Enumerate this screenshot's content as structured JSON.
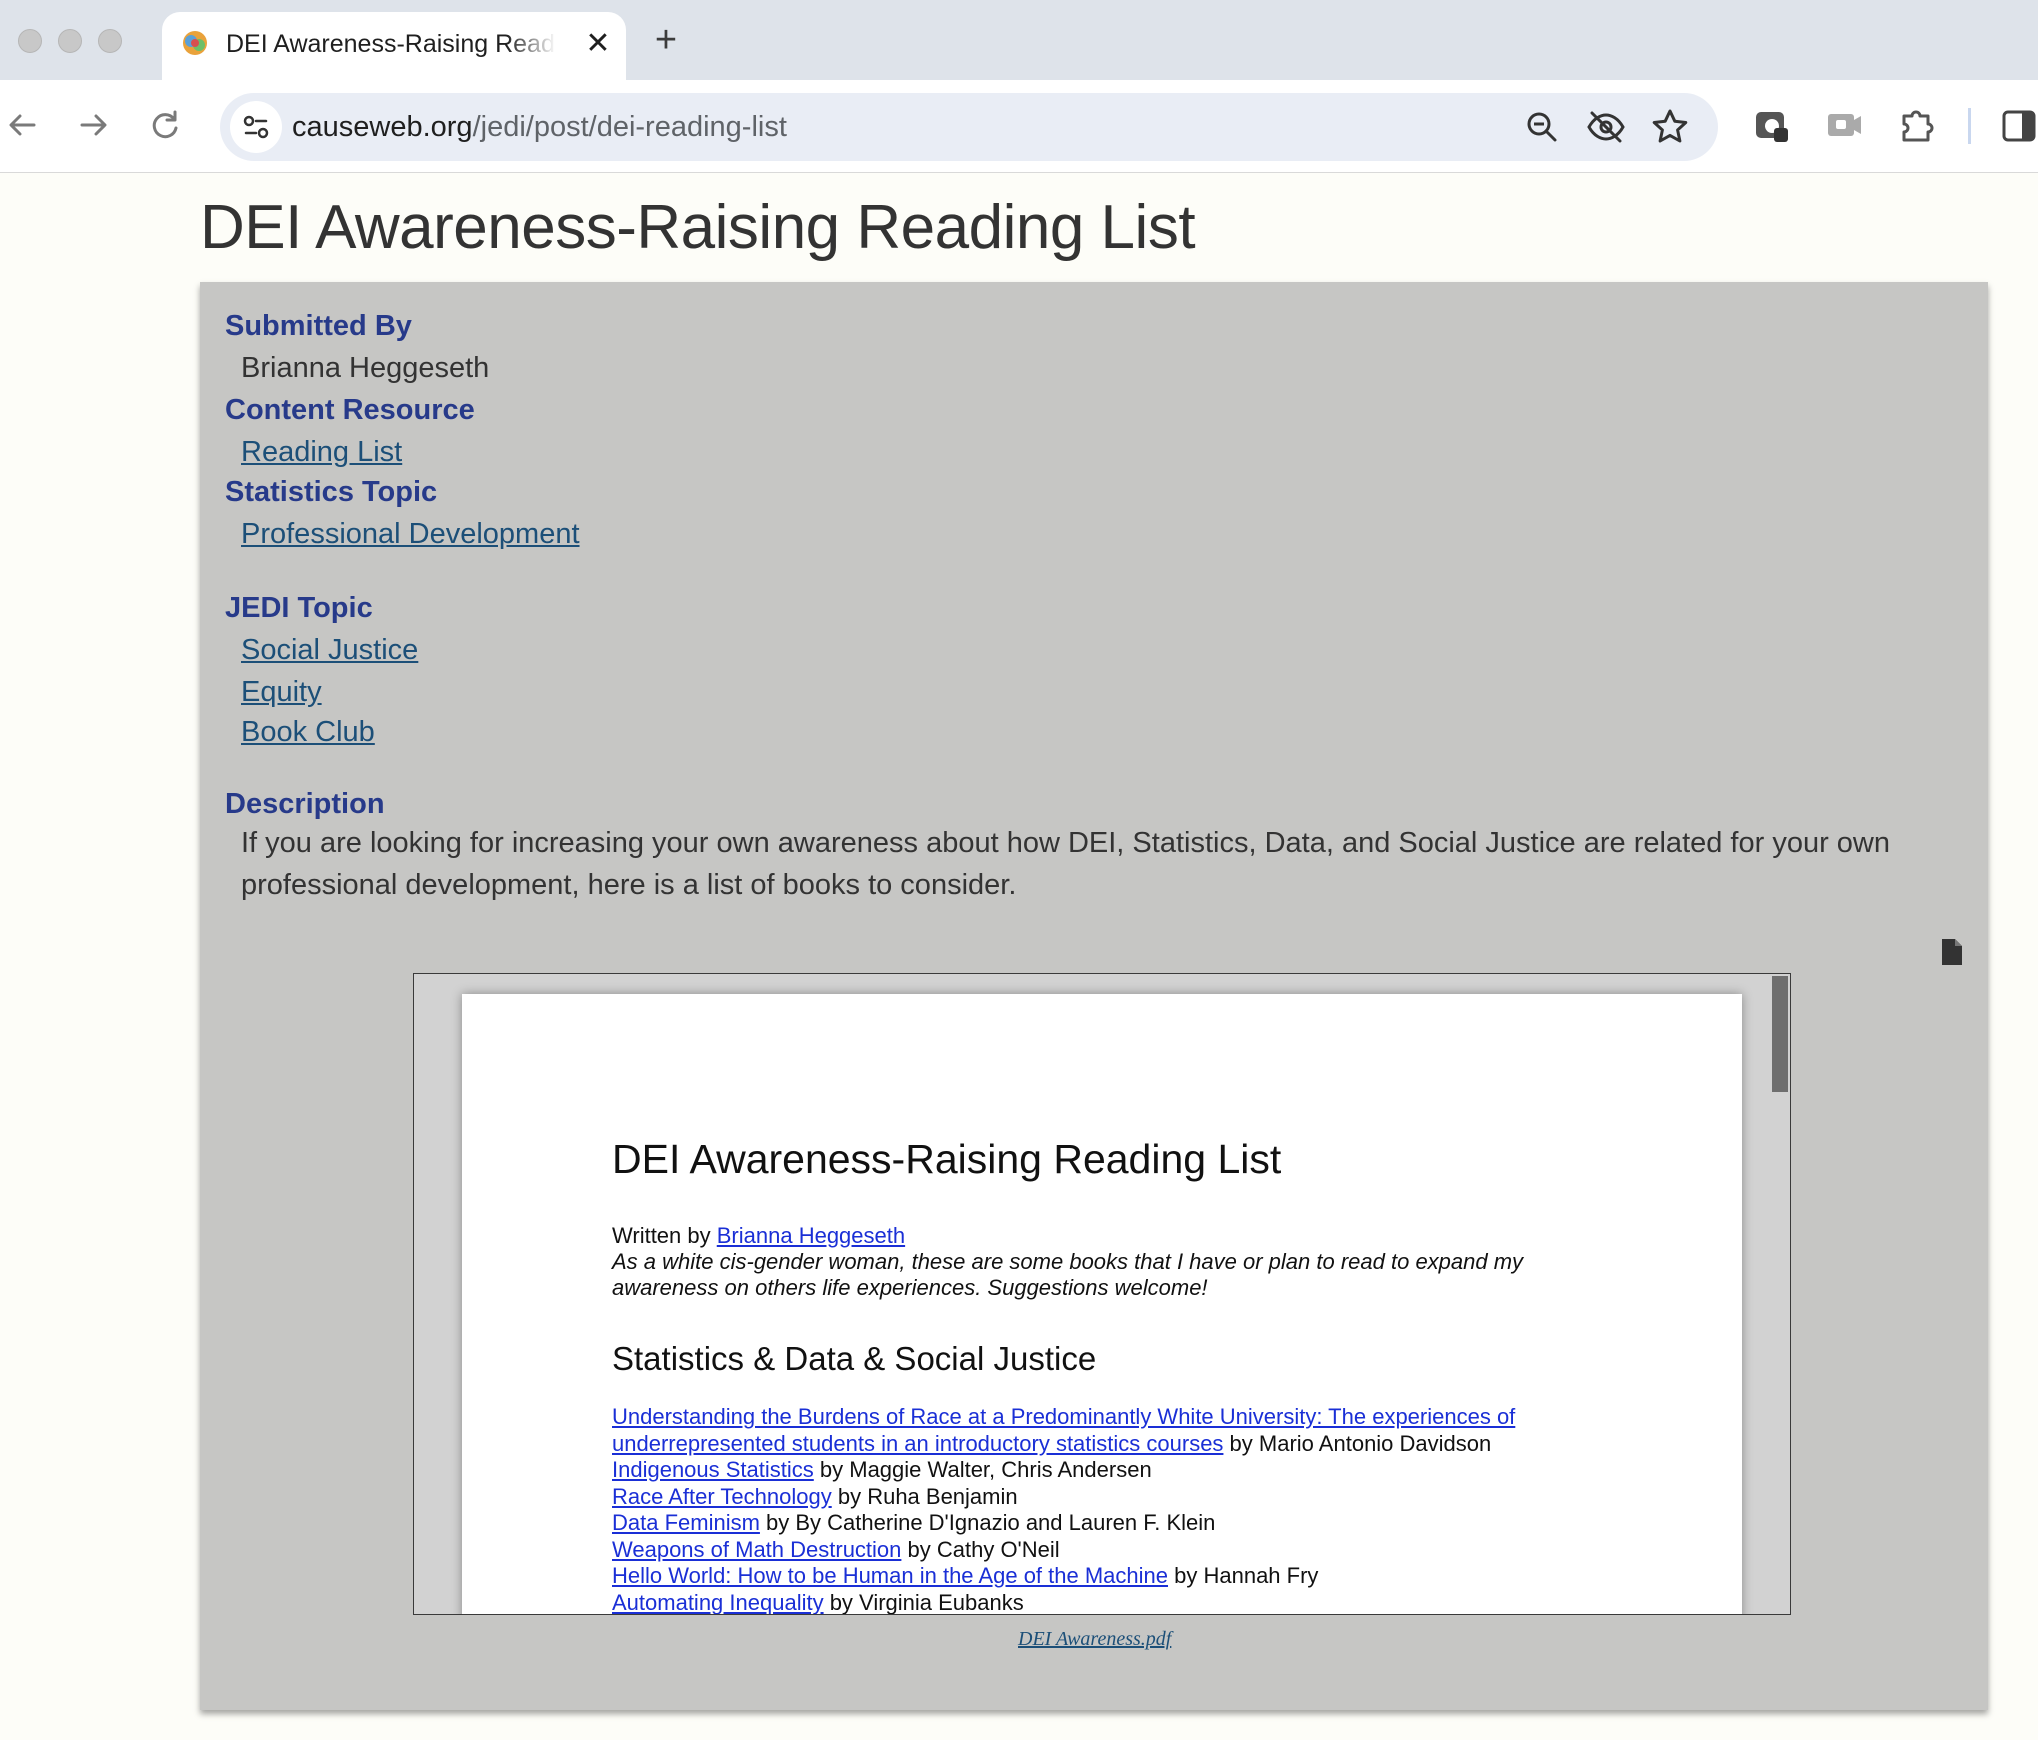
{
  "browser": {
    "tab_title": "DEI Awareness-Raising Reading List",
    "url_host": "causeweb.org",
    "url_path": "/jedi/post/dei-reading-list"
  },
  "page": {
    "title": "DEI Awareness-Raising Reading List",
    "submitted_by_label": "Submitted By",
    "submitted_by": "Brianna Heggeseth",
    "content_resource_label": "Content Resource",
    "content_resource": "Reading List",
    "statistics_topic_label": "Statistics Topic",
    "statistics_topic": "Professional Development",
    "jedi_topic_label": "JEDI Topic",
    "jedi_topics": [
      "Social Justice",
      "Equity",
      "Book Club"
    ],
    "description_label": "Description",
    "description": "If you are looking for increasing your own awareness about how DEI, Statistics, Data, and Social Justice are related for your own professional development, here is a list of books to consider."
  },
  "pdf": {
    "title": "DEI Awareness-Raising Reading List",
    "written_by": "Written by",
    "author": "Brianna Heggeseth",
    "intro_line1": "As a white cis-gender woman, these are some books that I have or plan to read to expand my",
    "intro_line2": "awareness on others life experiences. Suggestions welcome!",
    "section_title": "Statistics & Data & Social Justice",
    "books": [
      {
        "title": "Understanding the Burdens of Race at a Predominantly White University: The experiences of underrepresented students in an introductory statistics courses",
        "by": " by Mario Antonio Davidson"
      },
      {
        "title": "Indigenous Statistics",
        "by": " by Maggie Walter, Chris Andersen"
      },
      {
        "title": "Race After Technology",
        "by": " by Ruha Benjamin"
      },
      {
        "title": "Data Feminism",
        "by": " by By Catherine D'Ignazio and Lauren F. Klein"
      },
      {
        "title": "Weapons of Math Destruction",
        "by": " by Cathy O'Neil"
      },
      {
        "title": "Hello World: How to be Human in the Age of the Machine",
        "by": " by Hannah Fry"
      },
      {
        "title": "Automating Inequality",
        "by": " by Virginia Eubanks"
      }
    ],
    "file_name": "DEI Awareness.pdf"
  }
}
